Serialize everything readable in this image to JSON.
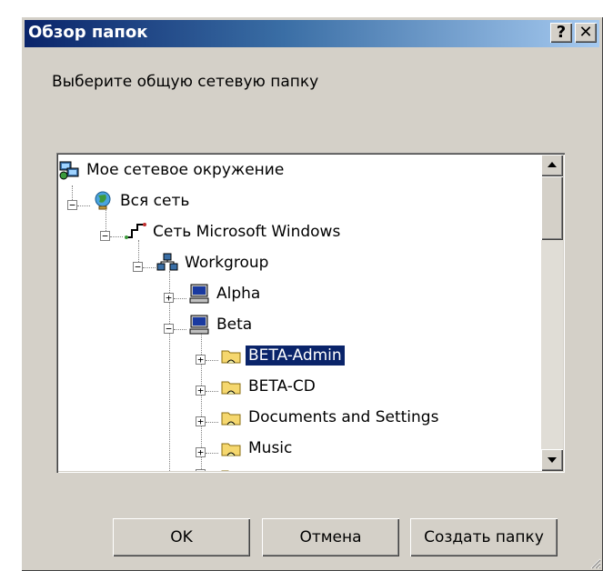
{
  "window": {
    "title": "Обзор папок",
    "help_label": "?",
    "close_label": "✕"
  },
  "prompt": "Выберите общую сетевую папку",
  "tree": {
    "nodes": [
      {
        "label": "Мое сетевое окружение",
        "icon": "network-places-icon",
        "level": 0
      },
      {
        "label": "Вся сеть",
        "icon": "globe-icon",
        "level": 1,
        "expanded": true
      },
      {
        "label": "Сеть Microsoft Windows",
        "icon": "network-icon",
        "level": 2,
        "expanded": true
      },
      {
        "label": "Workgroup",
        "icon": "workgroup-icon",
        "level": 3,
        "expanded": true
      },
      {
        "label": "Alpha",
        "icon": "computer-icon",
        "level": 4,
        "expanded": false
      },
      {
        "label": "Beta",
        "icon": "computer-icon",
        "level": 4,
        "expanded": true
      },
      {
        "label": "BETA-Admin",
        "icon": "shared-folder-icon",
        "level": 5,
        "expanded": false,
        "selected": true
      },
      {
        "label": "BETA-CD",
        "icon": "shared-folder-icon",
        "level": 5,
        "expanded": false
      },
      {
        "label": "Documents and Settings",
        "icon": "shared-folder-icon",
        "level": 5,
        "expanded": false
      },
      {
        "label": "Music",
        "icon": "shared-folder-icon",
        "level": 5,
        "expanded": false
      }
    ]
  },
  "buttons": {
    "ok": "OK",
    "cancel": "Отмена",
    "create_folder": "Создать папку"
  },
  "colors": {
    "titlebar_start": "#0a246a",
    "titlebar_end": "#a6caf0",
    "selection": "#0a246a",
    "face": "#d4d0c8"
  }
}
